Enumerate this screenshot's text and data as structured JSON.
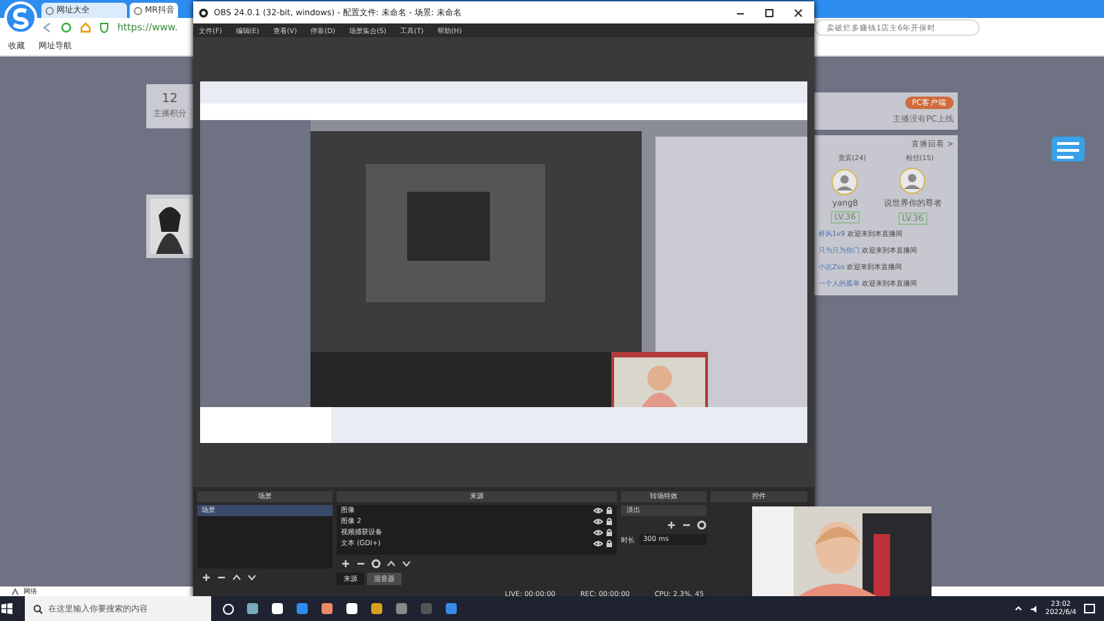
{
  "browser": {
    "tabs": [
      {
        "label": "网址大全",
        "selected": false
      },
      {
        "label": "MR抖音",
        "selected": true
      }
    ],
    "url": "https://www.",
    "search_value": "卖破烂多赚钱1店主6年开保时",
    "bookmarks": [
      "收藏",
      "网址导航"
    ],
    "page": {
      "counter": "12",
      "counter_caption": "主播积分",
      "pc_button": "PC客户端",
      "pc_caption": "主播没有PC上线",
      "replay": "直播回看 >",
      "follow_tabs": [
        "贵宾(24)",
        "粉丝(15)"
      ],
      "fans": [
        {
          "name": "yang8",
          "level": "LV.36"
        },
        {
          "name": "说世界你的尊者",
          "level": "LV.36"
        }
      ],
      "chat": [
        {
          "user": "桥风1v9",
          "text": "欢迎来到本直播间"
        },
        {
          "user": "只为只为你门",
          "text": "欢迎来到本直播间"
        },
        {
          "user": "小志Zso",
          "text": "欢迎来到本直播间"
        },
        {
          "user": "一个人的孤单",
          "text": "欢迎来到本直播间"
        }
      ]
    },
    "status": "网络"
  },
  "obs": {
    "title": "OBS 24.0.1 (32-bit, windows) - 配置文件: 未命名 - 场景: 未命名",
    "menu": [
      "文件(F)",
      "编辑(E)",
      "查看(V)",
      "停靠(D)",
      "场景集合(S)",
      "工具(T)",
      "帮助(H)"
    ],
    "scenes": {
      "title": "场景",
      "items": [
        {
          "label": "场景",
          "selected": true
        }
      ]
    },
    "sources": {
      "title": "来源",
      "items": [
        {
          "label": "图像",
          "visible": true
        },
        {
          "label": "图像 2",
          "visible": true
        },
        {
          "label": "视频捕获设备",
          "visible": true
        },
        {
          "label": "文本 (GDI+)",
          "visible": true
        }
      ]
    },
    "dock_tabs": [
      {
        "label": "来源",
        "selected": true
      },
      {
        "label": "混音器",
        "selected": false
      }
    ],
    "transitions": {
      "title": "转场特效",
      "effect": "淡出",
      "duration_label": "时长",
      "duration": "300 ms"
    },
    "controls": {
      "title": "控件"
    },
    "status": [
      "LIVE: 00:00:00",
      "REC: 00:00:00",
      "CPU: 2.3%, 45"
    ]
  },
  "taskbar": {
    "search_placeholder": "在这里输入你要搜索的内容",
    "time": "23:02",
    "date": "2022/6/4"
  }
}
